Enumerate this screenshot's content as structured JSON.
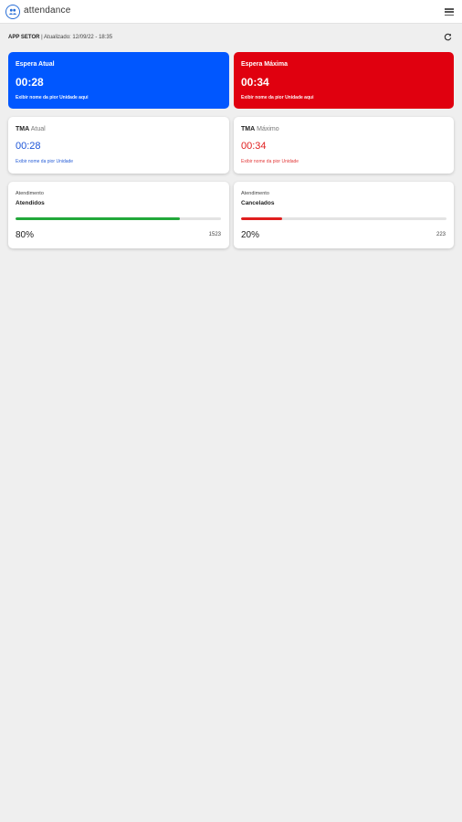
{
  "app": {
    "name": "attendance"
  },
  "subheader": {
    "sector": "APP SETOR",
    "updated": "| Atualizado: 12/09/22 - 18:35"
  },
  "cards": {
    "espera_atual": {
      "title": "Espera Atual",
      "time": "00:28",
      "footer": "Exibir nome da pior Unidade aqui",
      "color": "#0057ff"
    },
    "espera_maxima": {
      "title": "Espera Máxima",
      "time": "00:34",
      "footer": "Exibir nome da pior Unidade aqui",
      "color": "#e0000f"
    },
    "tma_atual": {
      "title": "TMA",
      "subtitle": "Atual",
      "time": "00:28",
      "footer": "Exibir nome da pior Unidade"
    },
    "tma_maximo": {
      "title": "TMA",
      "subtitle": "Máximo",
      "time": "00:34",
      "footer": "Exibir nome da pior Unidade"
    },
    "atendidos": {
      "label": "Atendimento",
      "name": "Atendidos",
      "percent_text": "80%",
      "progress": 0.8,
      "count": "1523",
      "color": "#22a83a"
    },
    "cancelados": {
      "label": "Atendimento",
      "name": "Cancelados",
      "percent_text": "20%",
      "progress": 0.2,
      "count": "223",
      "color": "#e01e1e"
    }
  },
  "icons": {
    "logo": "people-icon",
    "menu": "hamburger-menu-icon",
    "refresh": "refresh-icon"
  }
}
